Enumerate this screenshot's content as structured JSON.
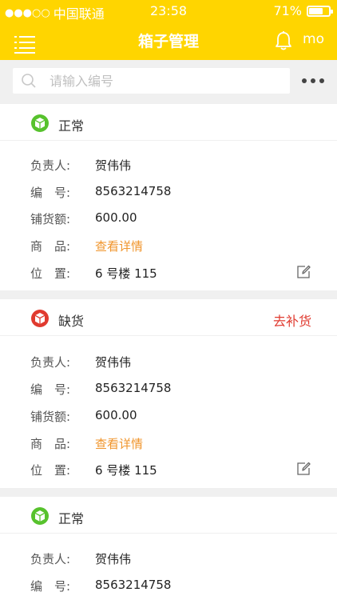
{
  "status_bar": {
    "signal": "●●●○○",
    "carrier": "中国联通",
    "time": "23:58",
    "battery": "71%",
    "battery_level": 0.71
  },
  "header": {
    "title": "箱子管理",
    "user": "mo"
  },
  "search": {
    "placeholder": "请输入编号"
  },
  "labels": {
    "owner": "负责人:",
    "number": "编　号:",
    "amount": "铺货额:",
    "goods": "商　品:",
    "location": "位　置:"
  },
  "boxes": [
    {
      "status": "正常",
      "status_color": "#57c22d",
      "action": "",
      "owner": "贺伟伟",
      "number": "8563214758",
      "amount": "600.00",
      "goods_link": "查看详情",
      "location": "6 号楼 115"
    },
    {
      "status": "缺货",
      "status_color": "#e03a2f",
      "action": "去补货",
      "owner": "贺伟伟",
      "number": "8563214758",
      "amount": "600.00",
      "goods_link": "查看详情",
      "location": "6 号楼 115"
    },
    {
      "status": "正常",
      "status_color": "#57c22d",
      "action": "",
      "owner": "贺伟伟",
      "number": "8563214758"
    }
  ],
  "colors": {
    "brand": "#ffd500",
    "link": "#f0952c",
    "alert": "#e03a2f",
    "ok": "#57c22d"
  }
}
